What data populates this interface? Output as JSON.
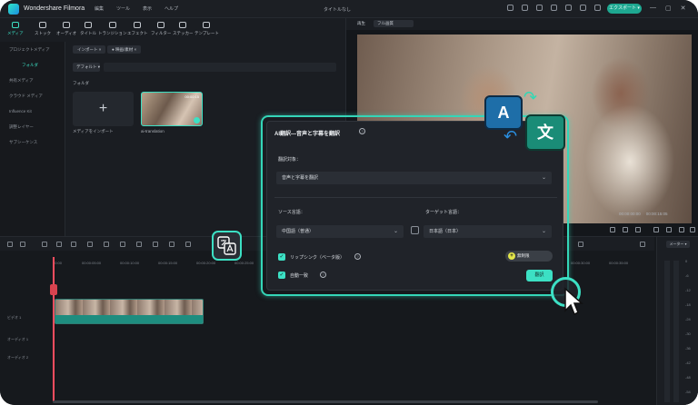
{
  "app": {
    "name": "Wondershare Filmora",
    "menus": [
      "編集",
      "ツール",
      "表示",
      "ヘルプ"
    ],
    "doc_title": "タイトルなし",
    "export_label": "エクスポート ▾",
    "window_controls": [
      "—",
      "▢",
      "✕"
    ]
  },
  "toolbar": {
    "items": [
      "メディア",
      "ストック",
      "オーディオ",
      "タイトル",
      "トランジション",
      "エフェクト",
      "フィルター",
      "ステッカー",
      "テンプレート"
    ]
  },
  "sidebar": {
    "items": [
      "プロジェクトメディア",
      "フォルダ",
      "共有メディア",
      "クラウド メディア",
      "Influence Kit",
      "調整レイヤー",
      "サブシーケンス"
    ]
  },
  "media": {
    "chips": [
      "インポート ×",
      "● 映画/素材 ×"
    ],
    "filter_label": "デフォルト ▾",
    "folder_label": "フォルダ",
    "import_label": "メディアをインポート",
    "thumb_label": "ai-translation",
    "thumb_duration": "00:00:15"
  },
  "player": {
    "tab_label": "再生",
    "quality_label": "フル画質",
    "time_current": "00:00:00:00",
    "time_total": "00:00:15:05"
  },
  "timeline": {
    "ruler_ticks": [
      "00:00",
      "00:00:05:00",
      "00:00:10:00",
      "00:00:15:00",
      "00:00:20:00",
      "00:00:25:00",
      "00:00:30:00",
      "00:00:35:00",
      "00:00:40:00",
      "00:00:45:00"
    ],
    "track_labels": [
      "ビデオ 1",
      "オーディオ 1",
      "オーディオ 2"
    ],
    "meter_label": "メーター ▾",
    "meter_scale": [
      "0",
      "-6",
      "-12",
      "-18",
      "-24",
      "-30",
      "-36",
      "-42",
      "-48",
      "-54"
    ]
  },
  "dialog": {
    "title": "AI翻訳—音声と字幕を翻訳",
    "target_label": "翻訳対象：",
    "target_value": "音声と字幕を翻訳",
    "source_label": "ソース言語：",
    "source_value": "中国語（普通）",
    "dest_label": "ターゲット言語：",
    "dest_value": "日本語（日本）",
    "lipsync_label": "リップシンク（ベータ版）",
    "automatch_label": "自動一致",
    "quota_label": "無制限",
    "translate_label": "翻訳"
  },
  "badges": {
    "letter_a": "A",
    "letter_x": "文",
    "translate_icon": "translate-icon"
  }
}
